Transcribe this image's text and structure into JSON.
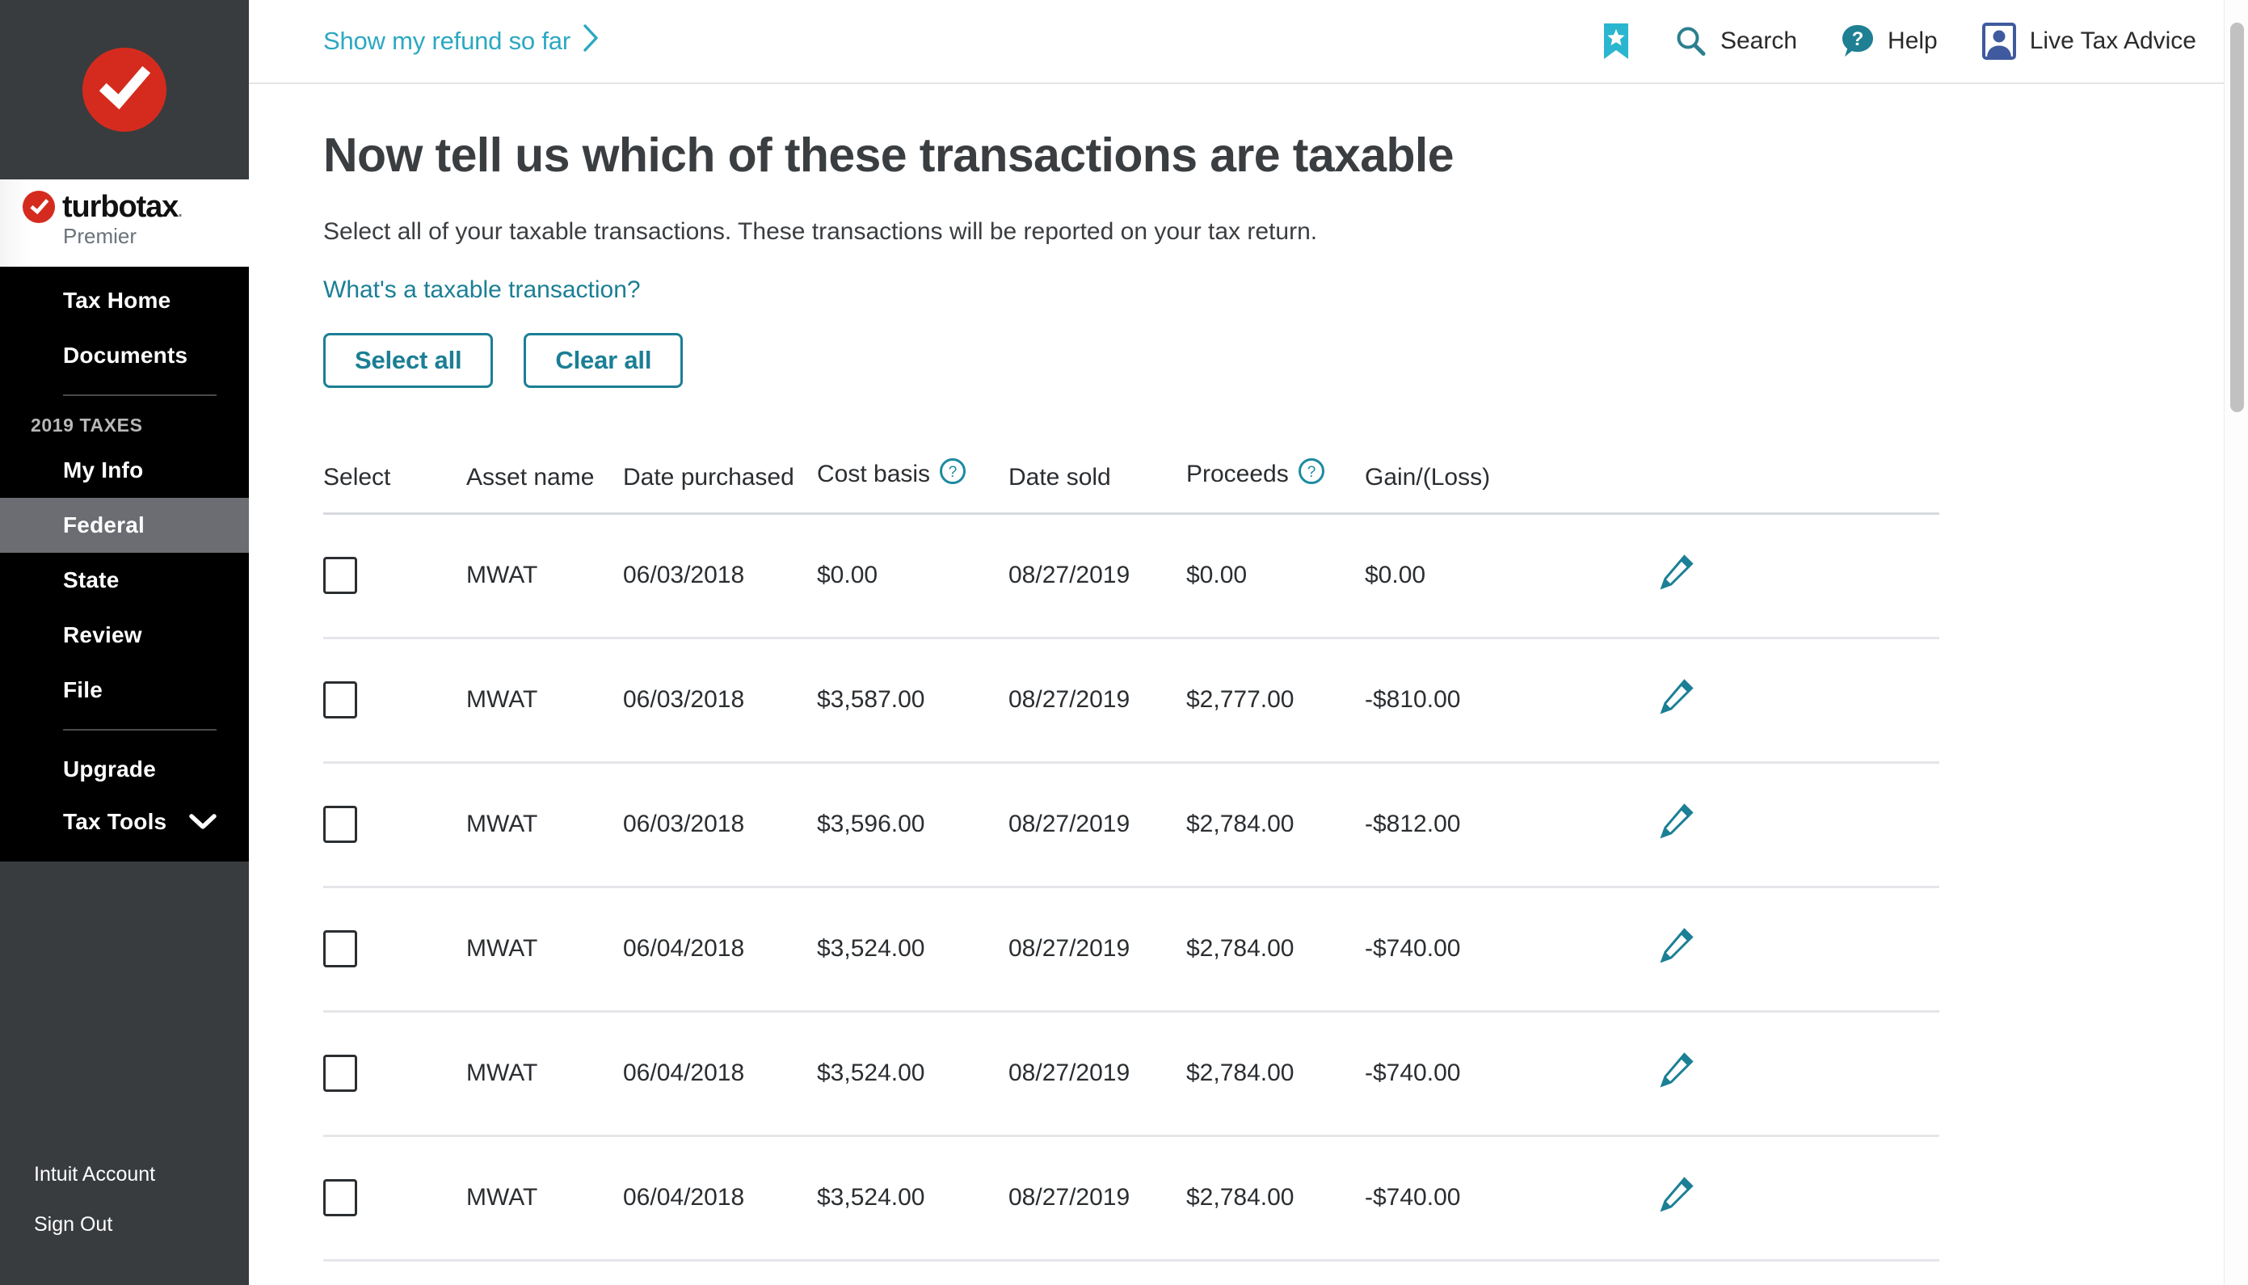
{
  "brand": {
    "name": "turbotax",
    "name_dot": ".",
    "edition": "Premier",
    "logo_icon": "checkmark-circle-icon",
    "accent_red": "#d52b1e"
  },
  "sidebar": {
    "primary_items": [
      {
        "label": "Tax Home",
        "active": false
      },
      {
        "label": "Documents",
        "active": false
      }
    ],
    "section_label": "2019 TAXES",
    "year_items": [
      {
        "label": "My Info",
        "active": false
      },
      {
        "label": "Federal",
        "active": true
      },
      {
        "label": "State",
        "active": false
      },
      {
        "label": "Review",
        "active": false
      },
      {
        "label": "File",
        "active": false
      }
    ],
    "tool_items": [
      {
        "label": "Upgrade",
        "chevron": false
      },
      {
        "label": "Tax Tools",
        "chevron": true,
        "chevron_icon": "chevron-down-icon"
      }
    ],
    "footer_items": [
      {
        "label": "Intuit Account"
      },
      {
        "label": "Sign Out"
      }
    ],
    "active_bg": "#6b6d72"
  },
  "topbar": {
    "refund_link": "Show my refund so far",
    "refund_chevron_icon": "chevron-right-icon",
    "bookmark_icon": "bookmark-star-icon",
    "actions": [
      {
        "label": "Search",
        "icon": "search-icon"
      },
      {
        "label": "Help",
        "icon": "help-question-icon"
      },
      {
        "label": "Live Tax Advice",
        "icon": "live-advisor-icon"
      }
    ],
    "link_color": "#2ca8c2"
  },
  "page": {
    "title": "Now tell us which of these transactions are taxable",
    "subtitle": "Select all of your taxable transactions. These transactions will be reported on your tax return.",
    "help_link": "What's a taxable transaction?",
    "select_all_label": "Select all",
    "clear_all_label": "Clear all",
    "accent_teal": "#1b7f95"
  },
  "table": {
    "columns": [
      {
        "label": "Select",
        "help": false
      },
      {
        "label": "Asset name",
        "help": false
      },
      {
        "label": "Date purchased",
        "help": false
      },
      {
        "label": "Cost basis",
        "help": true,
        "help_icon": "question-circle-icon"
      },
      {
        "label": "Date sold",
        "help": false
      },
      {
        "label": "Proceeds",
        "help": true,
        "help_icon": "question-circle-icon"
      },
      {
        "label": "Gain/(Loss)",
        "help": false
      }
    ],
    "edit_icon": "pencil-edit-icon",
    "rows": [
      {
        "selected": false,
        "asset": "MWAT",
        "date_purchased": "06/03/2018",
        "cost_basis": "$0.00",
        "date_sold": "08/27/2019",
        "proceeds": "$0.00",
        "gain_loss": "$0.00"
      },
      {
        "selected": false,
        "asset": "MWAT",
        "date_purchased": "06/03/2018",
        "cost_basis": "$3,587.00",
        "date_sold": "08/27/2019",
        "proceeds": "$2,777.00",
        "gain_loss": "-$810.00"
      },
      {
        "selected": false,
        "asset": "MWAT",
        "date_purchased": "06/03/2018",
        "cost_basis": "$3,596.00",
        "date_sold": "08/27/2019",
        "proceeds": "$2,784.00",
        "gain_loss": "-$812.00"
      },
      {
        "selected": false,
        "asset": "MWAT",
        "date_purchased": "06/04/2018",
        "cost_basis": "$3,524.00",
        "date_sold": "08/27/2019",
        "proceeds": "$2,784.00",
        "gain_loss": "-$740.00"
      },
      {
        "selected": false,
        "asset": "MWAT",
        "date_purchased": "06/04/2018",
        "cost_basis": "$3,524.00",
        "date_sold": "08/27/2019",
        "proceeds": "$2,784.00",
        "gain_loss": "-$740.00"
      },
      {
        "selected": false,
        "asset": "MWAT",
        "date_purchased": "06/04/2018",
        "cost_basis": "$3,524.00",
        "date_sold": "08/27/2019",
        "proceeds": "$2,784.00",
        "gain_loss": "-$740.00"
      }
    ]
  }
}
